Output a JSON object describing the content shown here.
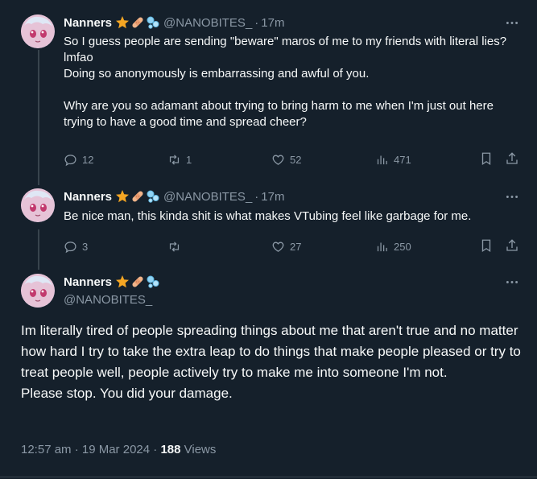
{
  "tweets": [
    {
      "name": "Nanners",
      "handle": "@NANOBITES_",
      "dot": "·",
      "time": "17m",
      "text": "So I guess people are sending \"beware\" maros of me to my friends with literal lies? lmfao\nDoing so anonymously is embarrassing and awful of you.\n\nWhy are you so adamant about trying to bring harm to me when I'm just out here trying to have a good time and spread cheer?",
      "replies": "12",
      "retweets": "1",
      "likes": "52",
      "views": "471"
    },
    {
      "name": "Nanners",
      "handle": "@NANOBITES_",
      "dot": "·",
      "time": "17m",
      "text": "Be nice man, this kinda shit is what makes VTubing feel like garbage for me.",
      "replies": "3",
      "retweets": "",
      "likes": "27",
      "views": "250"
    }
  ],
  "main": {
    "name": "Nanners",
    "handle": "@NANOBITES_",
    "text": "Im literally tired of people spreading things about me that aren't true and no matter how hard I try to take the extra leap to do things that make people pleased or try to treat people well, people actively try to make me into someone I'm not.\nPlease stop. You did your damage.",
    "timestamp": "12:57 am · 19 Mar 2024 · ",
    "views_count": "188",
    "views_label": " Views"
  },
  "icons": [
    "star-icon",
    "bandage-icon",
    "bubbles-icon",
    "more-icon",
    "reply-icon",
    "retweet-icon",
    "like-icon",
    "views-icon",
    "bookmark-icon",
    "share-icon"
  ],
  "colors": {
    "background": "#15202b",
    "muted": "#8b98a5",
    "text": "#f7f9f9",
    "border": "#38444d"
  }
}
